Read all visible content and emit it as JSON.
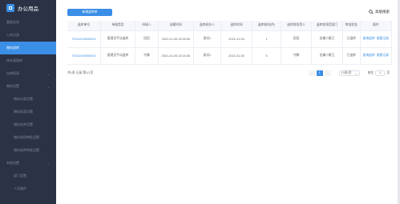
{
  "app": {
    "title": "办公用品"
  },
  "sidebar": {
    "items": [
      {
        "label": "基础信息",
        "active": false,
        "chevron": false,
        "sub": false
      },
      {
        "label": "入库记录",
        "active": false,
        "chevron": false,
        "sub": false
      },
      {
        "label": "物料退库",
        "active": true,
        "chevron": false,
        "sub": false
      },
      {
        "label": "库存清理单",
        "active": false,
        "chevron": false,
        "sub": false
      },
      {
        "label": "出库报表",
        "active": false,
        "chevron": true,
        "sub": false
      },
      {
        "label": "物料设置",
        "active": false,
        "chevron": true,
        "sub": false
      },
      {
        "label": "物料分类设置",
        "active": false,
        "chevron": false,
        "sub": true
      },
      {
        "label": "物料档案设置",
        "active": false,
        "chevron": false,
        "sub": true
      },
      {
        "label": "物料仓库设置",
        "active": false,
        "chevron": false,
        "sub": true
      },
      {
        "label": "物料领用审批设置",
        "active": false,
        "chevron": false,
        "sub": true
      },
      {
        "label": "物料退库审批设置",
        "active": false,
        "chevron": false,
        "sub": true
      },
      {
        "label": "系统设置",
        "active": false,
        "chevron": true,
        "sub": false
      },
      {
        "label": "部门设置",
        "active": false,
        "chevron": false,
        "sub": true
      },
      {
        "label": "人员维护",
        "active": false,
        "chevron": false,
        "sub": true
      }
    ]
  },
  "toolbar": {
    "new_label": "新增退库单",
    "search_label": "高级搜索"
  },
  "table": {
    "headers": [
      "退库单号",
      "单据类型",
      "申请人",
      "创建时间",
      "退库经办人",
      "退库时间",
      "退库耗材(件)",
      "退库前领用人",
      "退库前领用部门",
      "审批状态",
      "操作"
    ],
    "rows": [
      {
        "id": "TK202106050002",
        "type": "管理员手动退库",
        "applicant": "田田",
        "created": "2021-01-05 13:28:56",
        "handler": "测试1",
        "return_time": "2021-01-04",
        "qty": "1",
        "prev_user": "田田",
        "prev_dept": "金蝶小蜜王",
        "status": "已退库",
        "action1": "查询退库",
        "action2": "查看记录"
      },
      {
        "id": "TK202106050001",
        "type": "管理员手动退库",
        "applicant": "守静",
        "created": "2021-01-05 13:24:46",
        "handler": "测试1",
        "return_time": "2021-01-05",
        "qty": "5",
        "prev_user": "守静",
        "prev_dept": "金蝶小蜜王",
        "status": "已退库",
        "action1": "查询退库",
        "action2": "查看记录"
      }
    ]
  },
  "pager": {
    "total": "共1条 记录  第1/1页",
    "page": "1",
    "size": "10条/页",
    "goto_label": "前往",
    "goto_value": "1",
    "page_suffix": "页"
  },
  "colors": {
    "sidebar": "#2b3245",
    "accent": "#3a8ee6"
  }
}
